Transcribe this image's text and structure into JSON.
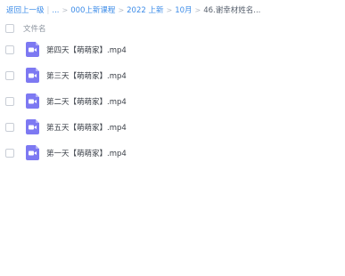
{
  "breadcrumb": {
    "back": "返回上一级",
    "ellipsis": "...",
    "items": [
      "000上新课程",
      "2022 上新",
      "10月"
    ],
    "current": "46.谢幸材姓名...",
    "separator": ">"
  },
  "list_header": {
    "column_label": "文件名"
  },
  "files": [
    {
      "name": "第四天【萌萌家】.mp4",
      "icon": "video-file-icon"
    },
    {
      "name": "第三天【萌萌家】.mp4",
      "icon": "video-file-icon"
    },
    {
      "name": "第二天【萌萌家】.mp4",
      "icon": "video-file-icon"
    },
    {
      "name": "第五天【萌萌家】.mp4",
      "icon": "video-file-icon"
    },
    {
      "name": "第一天【萌萌家】.mp4",
      "icon": "video-file-icon"
    }
  ],
  "colors": {
    "link": "#3d8ce8",
    "file_icon": "#7d79f2"
  }
}
